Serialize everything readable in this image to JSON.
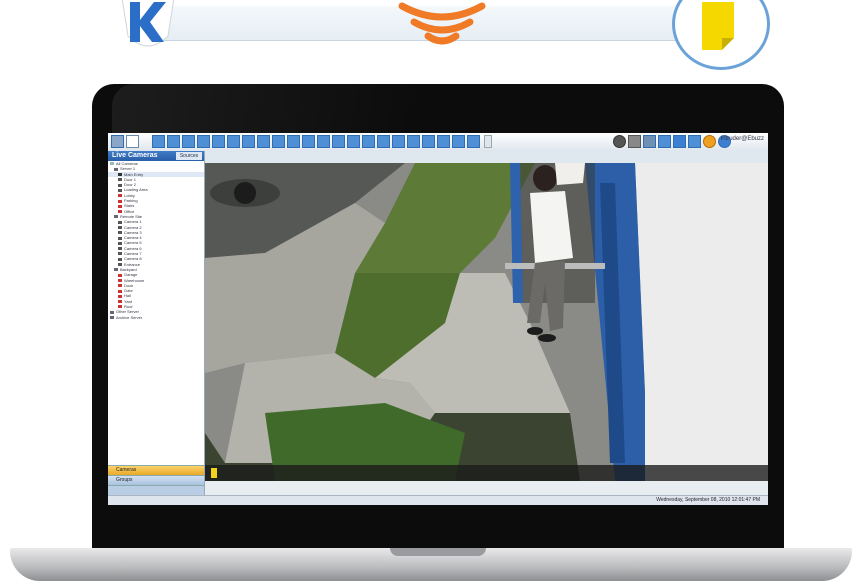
{
  "colors": {
    "accent_blue": "#4f8fd6",
    "signal_orange": "#f07a25",
    "doc_yellow": "#f5d800",
    "logo_blue": "#2b6ec8"
  },
  "icons": {
    "brand_logo": "k-shield-logo-icon",
    "wireless": "wifi-signal-icon",
    "document": "document-icon"
  },
  "app": {
    "sidebar": {
      "title": "Live Cameras",
      "tab": "Sources",
      "items": [
        {
          "label": "All Cameras"
        },
        {
          "label": "Server 1"
        },
        {
          "label": "Main Entry"
        },
        {
          "label": "Door 1"
        },
        {
          "label": "Door 2"
        },
        {
          "label": "Loading Area"
        },
        {
          "label": "Lobby"
        },
        {
          "label": "Parking"
        },
        {
          "label": "Stairs"
        },
        {
          "label": "Office"
        },
        {
          "label": "Remote Site"
        },
        {
          "label": "Camera 1"
        },
        {
          "label": "Camera 2"
        },
        {
          "label": "Camera 3"
        },
        {
          "label": "Camera 4"
        },
        {
          "label": "Camera 5"
        },
        {
          "label": "Camera 6"
        },
        {
          "label": "Camera 7"
        },
        {
          "label": "Camera 8"
        },
        {
          "label": "Entrance"
        },
        {
          "label": "Backyard"
        },
        {
          "label": "Garage"
        },
        {
          "label": "Warehouse"
        },
        {
          "label": "Dock"
        },
        {
          "label": "Gate"
        },
        {
          "label": "Hall"
        },
        {
          "label": "Yard"
        },
        {
          "label": "Roof"
        },
        {
          "label": "Other Server"
        },
        {
          "label": "Archive Server"
        }
      ],
      "bottom_buttons": [
        {
          "label": "Cameras"
        },
        {
          "label": "Groups"
        }
      ]
    },
    "toolbar": {
      "user_label": "Intruder@Ebuzz"
    },
    "status": {
      "text": "Wednesday, September 08, 2010   12:01:47 PM"
    }
  }
}
